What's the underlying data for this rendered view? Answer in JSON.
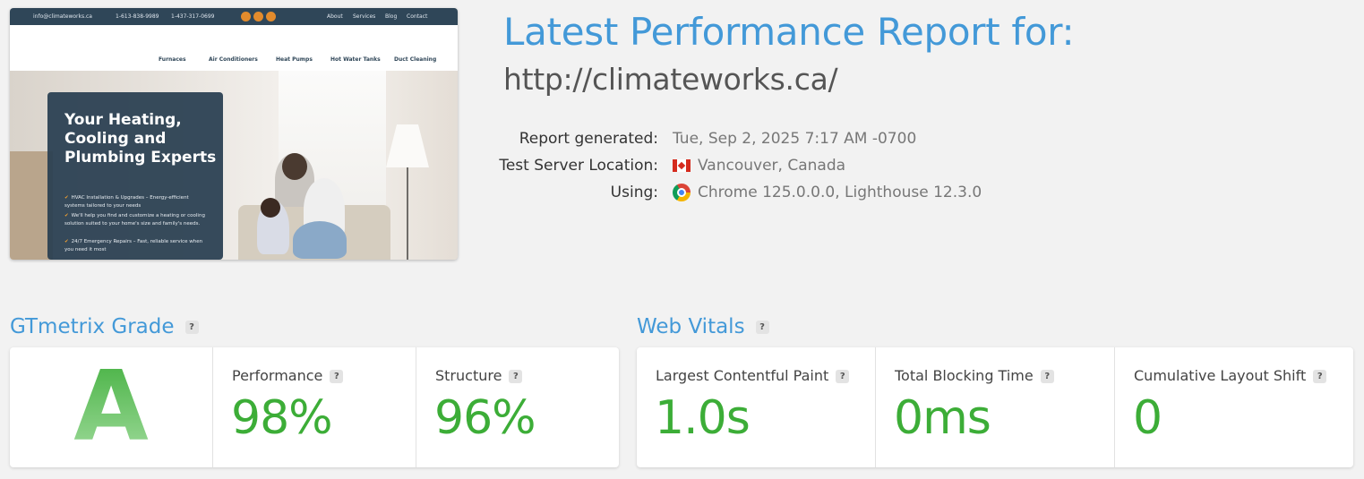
{
  "thumbnail": {
    "topbar": {
      "email": "info@climateworks.ca",
      "phone1": "1-613-838-9989",
      "phone2": "1-437-317-0699",
      "links": [
        "About",
        "Services",
        "Blog",
        "Contact"
      ]
    },
    "nav": [
      "Furnaces",
      "Air Conditioners",
      "Heat Pumps",
      "Hot Water Tanks",
      "Duct Cleaning"
    ],
    "hero_heading": "Your Heating, Cooling and Plumbing Experts",
    "bullets": [
      "HVAC Installation & Upgrades – Energy-efficient systems tailored to your needs",
      "We'll help you find and customize a heating or cooling solution suited to your home's size and family's needs.",
      "24/7 Emergency Repairs – Fast, reliable service when you need it most"
    ]
  },
  "report": {
    "title": "Latest Performance Report for:",
    "url": "http://climateworks.ca/",
    "meta": [
      {
        "label": "Report generated:",
        "value": "Tue, Sep 2, 2025 7:17 AM -0700",
        "icon": ""
      },
      {
        "label": "Test Server Location:",
        "value": "Vancouver, Canada",
        "icon": "canada-flag-icon"
      },
      {
        "label": "Using:",
        "value": "Chrome 125.0.0.0, Lighthouse 12.3.0",
        "icon": "chrome-icon"
      }
    ]
  },
  "grade_section": {
    "title": "GTmetrix Grade",
    "help": "?",
    "grade": "A",
    "performance": {
      "label": "Performance",
      "value": "98%"
    },
    "structure": {
      "label": "Structure",
      "value": "96%"
    }
  },
  "vitals_section": {
    "title": "Web Vitals",
    "help": "?",
    "lcp": {
      "label": "Largest Contentful Paint",
      "value": "1.0s"
    },
    "tbt": {
      "label": "Total Blocking Time",
      "value": "0ms"
    },
    "cls": {
      "label": "Cumulative Layout Shift",
      "value": "0"
    }
  },
  "colors": {
    "accent_blue": "#4399d8",
    "grade_green": "#3cad37",
    "background": "#f2f2f2"
  }
}
